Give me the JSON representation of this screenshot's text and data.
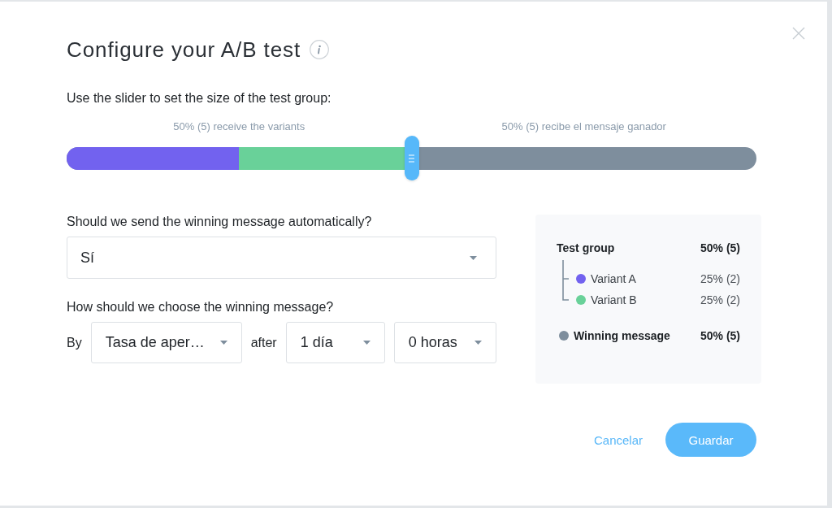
{
  "dialog": {
    "title": "Configure your A/B test"
  },
  "slider": {
    "instruction": "Use the slider to set the size of the test group:",
    "captions": [
      "50% (5) receive the variants",
      "50% (5) recibe el mensaje ganador"
    ],
    "level": 0.5,
    "segments": [
      {
        "color": "#7262ef"
      },
      {
        "color": "#69d199"
      }
    ]
  },
  "auto_send": {
    "label": "Should we send the winning message automatically?",
    "value": "Sí"
  },
  "winner_criteria": {
    "label": "How should we choose the winning message?",
    "parts": [
      {
        "kind": "text",
        "text": "By"
      },
      {
        "kind": "select",
        "value": "Tasa de aper…"
      },
      {
        "kind": "text",
        "text": "after"
      },
      {
        "kind": "select",
        "value": "1 día"
      },
      {
        "kind": "select",
        "value": "0 horas"
      }
    ]
  },
  "summary": {
    "items": [
      {
        "label": "Test group",
        "value": "50% (5)",
        "children": [
          {
            "label": "Variant A",
            "value": "25% (2)",
            "color": "#7262ef"
          },
          {
            "label": "Variant B",
            "value": "25% (2)",
            "color": "#69d199"
          }
        ]
      },
      {
        "label": "Winning message",
        "value": "50% (5)",
        "color": "#7e8e9d"
      }
    ]
  },
  "buttons": [
    {
      "kind": "link",
      "label": "Cancelar"
    },
    {
      "kind": "primary",
      "label": "Guardar"
    }
  ]
}
